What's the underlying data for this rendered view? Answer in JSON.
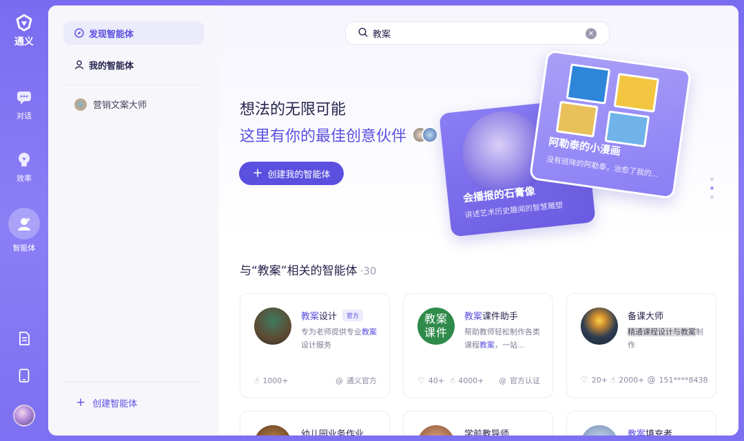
{
  "rail": {
    "brand": "通义",
    "items": [
      {
        "label": "对话",
        "icon": "chat-icon"
      },
      {
        "label": "效率",
        "icon": "bulb-icon"
      },
      {
        "label": "智能体",
        "icon": "agent-icon"
      }
    ]
  },
  "sidebar": {
    "discover": "发现智能体",
    "mine": "我的智能体",
    "recent": "营销文案大师",
    "create": "创建智能体"
  },
  "search": {
    "value": "教案"
  },
  "hero": {
    "title": "想法的无限可能",
    "subtitle": "这里有你的最佳创意伙伴",
    "cta": "创建我的智能体",
    "featured": [
      {
        "title": "会播报的石膏像",
        "desc": "讲述艺术历史趣闻的智慧雕塑"
      },
      {
        "title": "阿勒泰的小漫画",
        "desc": "没有班味的阿勒泰，治愈了我的..."
      }
    ]
  },
  "results": {
    "prefix": "与“教案”相关的智能体",
    "count": "30",
    "cards": [
      {
        "name_hl": "教案",
        "name_rest": "设计",
        "badge": "官方",
        "desc_hl1": "",
        "desc": "专为老师提供专业",
        "desc_hl2": "教案",
        "desc_rest": "设计服务",
        "uses": "1000+",
        "author": "通义官方"
      },
      {
        "name_hl": "教案",
        "name_rest": "课件助手",
        "avatar_text": "教案课件",
        "desc": "帮助教师轻松制作各类课程",
        "desc_hl2": "教案",
        "desc_rest": "，一站...",
        "likes": "40+",
        "uses": "4000+",
        "author": "官方认证"
      },
      {
        "name": "备课大师",
        "desc_sel": "精通课程设计与教案",
        "desc_rest": "制作",
        "likes": "20+",
        "uses": "2000+",
        "author": "151****8438"
      },
      {
        "name": "幼儿园业务作业..."
      },
      {
        "name": "学前教导师"
      },
      {
        "name_hl": "教案",
        "name_rest": "填充者"
      }
    ]
  },
  "colors": {
    "accent": "#5b4fe0",
    "rail": "#7a6cf0"
  }
}
